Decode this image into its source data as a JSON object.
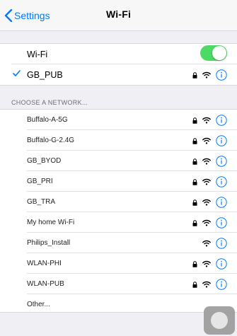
{
  "nav": {
    "back_label": "Settings",
    "title": "Wi-Fi"
  },
  "wifi_toggle": {
    "label": "Wi-Fi",
    "on": true
  },
  "connected_network": {
    "name": "GB_PUB",
    "secured": true
  },
  "section_header": "CHOOSE A NETWORK...",
  "networks": [
    {
      "name": "Buffalo-A-5G",
      "secured": true
    },
    {
      "name": "Buffalo-G-2.4G",
      "secured": true
    },
    {
      "name": "GB_BYOD",
      "secured": true
    },
    {
      "name": "GB_PRI",
      "secured": true
    },
    {
      "name": "GB_TRA",
      "secured": true
    },
    {
      "name": "My home Wi-Fi",
      "secured": true
    },
    {
      "name": "Philips_Install",
      "secured": false
    },
    {
      "name": "WLAN-PHI",
      "secured": true
    },
    {
      "name": "WLAN-PUB",
      "secured": true
    },
    {
      "name": "Other...",
      "other": true
    }
  ],
  "colors": {
    "accent": "#007aff",
    "toggle_on": "#4cd964",
    "background": "#efeff4"
  },
  "icons": [
    "chevron-left-icon",
    "check-icon",
    "lock-icon",
    "wifi-icon",
    "info-icon",
    "home-button-icon"
  ]
}
